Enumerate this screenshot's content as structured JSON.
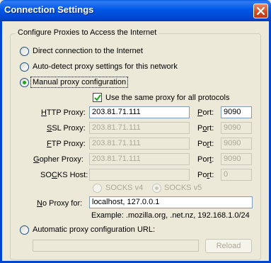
{
  "window": {
    "title": "Connection Settings"
  },
  "group": {
    "legend": "Configure Proxies to Access the Internet"
  },
  "modes": {
    "direct": "Direct connection to the Internet",
    "auto_detect": "Auto-detect proxy settings for this network",
    "manual": "Manual proxy configuration",
    "manual_selected": true,
    "auto_url": "Automatic proxy configuration URL:"
  },
  "same_proxy": {
    "label": "Use the same proxy for all protocols",
    "checked": true
  },
  "proxies": {
    "http": {
      "label": "HTTP Proxy:",
      "host": "203.81.71.111",
      "port_label": "Port:",
      "port": "9090"
    },
    "ssl": {
      "label": "SSL Proxy:",
      "host": "203.81.71.111",
      "port_label": "Port:",
      "port": "9090"
    },
    "ftp": {
      "label": "FTP Proxy:",
      "host": "203.81.71.111",
      "port_label": "Port:",
      "port": "9090"
    },
    "gopher": {
      "label": "Gopher Proxy:",
      "host": "203.81.71.111",
      "port_label": "Port:",
      "port": "9090"
    },
    "socks": {
      "label": "SOCKS Host:",
      "host": "",
      "port_label": "Port:",
      "port": "0"
    }
  },
  "socks_version": {
    "v4": "SOCKS v4",
    "v5": "SOCKS v5",
    "selected": "v5"
  },
  "no_proxy": {
    "label": "No Proxy for:",
    "value": "localhost, 127.0.0.1",
    "example": "Example: .mozilla.org, .net.nz, 192.168.1.0/24"
  },
  "auto_config": {
    "url": "",
    "reload": "Reload"
  },
  "icons": {
    "close": "close-icon",
    "check": "check-icon"
  }
}
